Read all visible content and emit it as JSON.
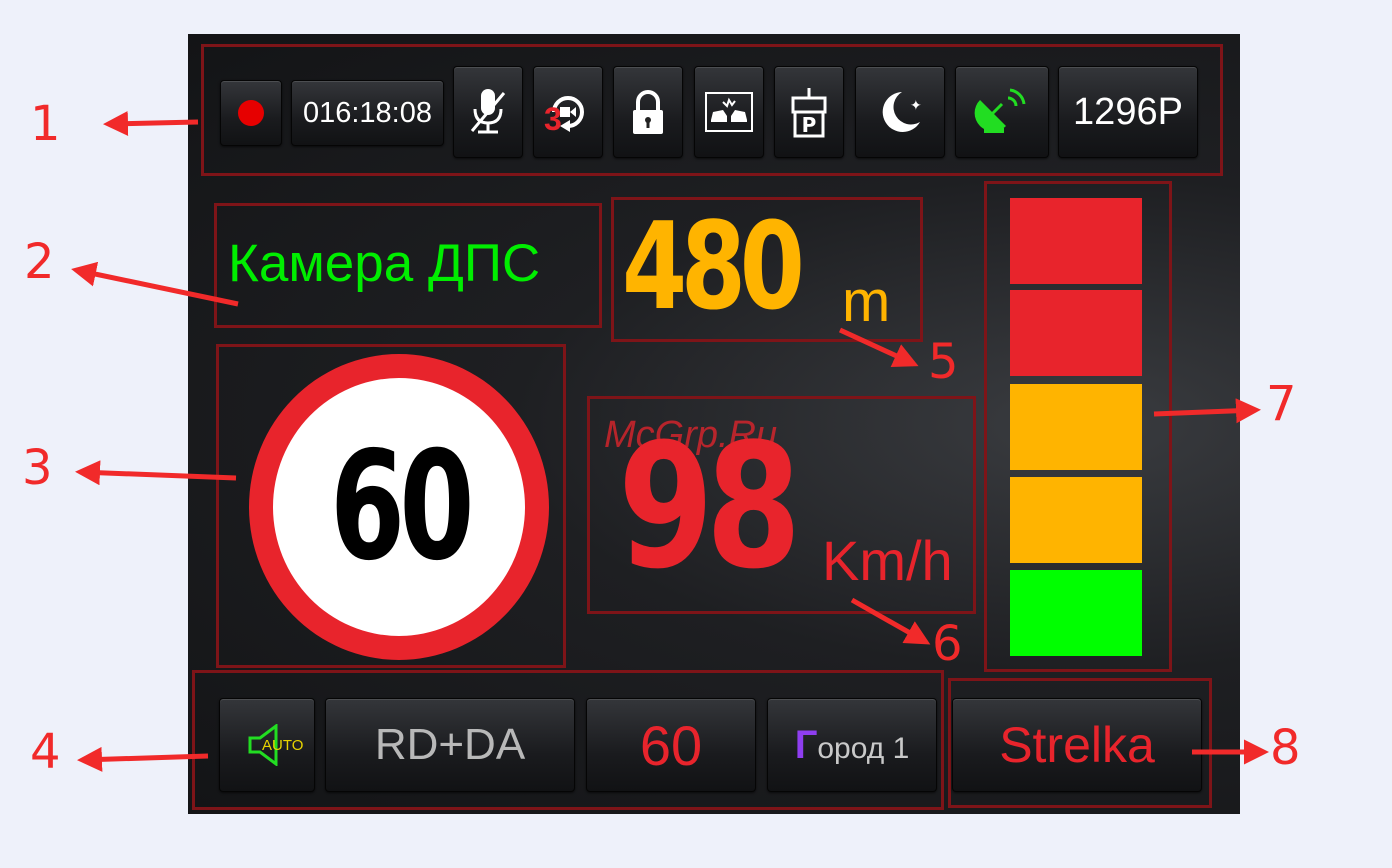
{
  "toolbar": {
    "timer": "016:18:08",
    "replay_badge": "3",
    "resolution": "1296P",
    "icons": [
      "record-dot-icon",
      "mic-muted-icon",
      "loop-recording-icon",
      "lock-icon",
      "collision-icon",
      "parking-icon",
      "night-mode-icon",
      "satellite-dish-icon"
    ]
  },
  "alert": {
    "camera_label": "Камера ДПС",
    "distance_value": "480",
    "distance_unit": "m"
  },
  "speed_limit": {
    "value": "60"
  },
  "speed": {
    "value": "98",
    "unit": "Km/h"
  },
  "signal_bars": {
    "colors": [
      "#e8242c",
      "#e8242c",
      "#ffb400",
      "#ffb400",
      "#00ff00"
    ]
  },
  "bottom": {
    "volume_mode": "AUTO",
    "radar_mode": "RD+DA",
    "limit": "60",
    "city_prefix": "Г",
    "city_rest": "ород 1",
    "strelka": "Strelka"
  },
  "callouts": [
    "1",
    "2",
    "3",
    "4",
    "5",
    "6",
    "7",
    "8"
  ],
  "watermark": "McGrp.Ru",
  "colors": {
    "green": "#00ff00",
    "orange": "#ffb400",
    "red": "#e8242c",
    "outline": "#7e1418"
  }
}
